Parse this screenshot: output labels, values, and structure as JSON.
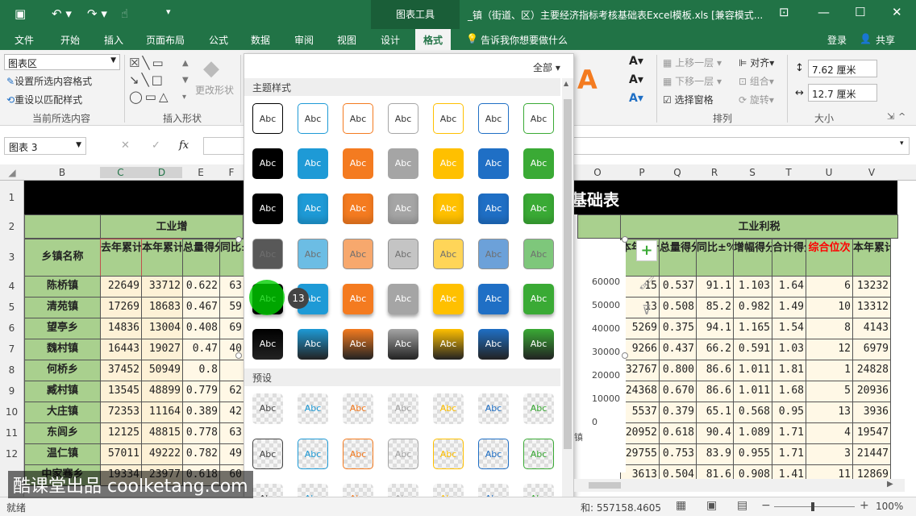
{
  "window": {
    "doc_title": "_镇（街道、区）主要经济指标考核基础表Excel模板.xls  [兼容模式...",
    "context_tools": "图表工具"
  },
  "tabs": [
    "文件",
    "开始",
    "插入",
    "页面布局",
    "公式",
    "数据",
    "审阅",
    "视图",
    "设计",
    "格式"
  ],
  "tell_me": "告诉我你想要做什么",
  "login": "登录",
  "share": "共享",
  "ribbon": {
    "selection_dropdown": "图表区",
    "format_selection": "设置所选内容格式",
    "reset_style": "重设以匹配样式",
    "group_current": "当前所选内容",
    "group_shapes": "插入形状",
    "change_shape": "更改形状",
    "bring_forward": "上移一层",
    "send_backward": "下移一层",
    "selection_pane": "选择窗格",
    "align": "对齐",
    "group": "组合",
    "rotate": "旋转",
    "group_arrange": "排列",
    "height": "7.62 厘米",
    "width": "12.7 厘米",
    "group_size": "大小"
  },
  "namebox": "图表 3",
  "fx": "fx",
  "gallery": {
    "filter": "全部",
    "section_theme": "主题样式",
    "section_preset": "预设",
    "swatch_label": "Abc",
    "callout": "13",
    "theme_colors": [
      "#000000",
      "#1e9ad6",
      "#f47b20",
      "#a5a5a5",
      "#ffc000",
      "#1f6fc5",
      "#3aaa35"
    ]
  },
  "columns_left": [
    "B",
    "C",
    "D",
    "E",
    "F"
  ],
  "columns_right": [
    "O",
    "P",
    "Q",
    "R",
    "S",
    "T",
    "U",
    "V"
  ],
  "rows": [
    "1",
    "2",
    "3",
    "4",
    "5",
    "6",
    "7",
    "8",
    "9",
    "10",
    "11",
    "12"
  ],
  "sheet": {
    "title_tail": "基础表",
    "group_industry_add": "工业增",
    "group_industry_profit": "工业利税",
    "hdr_left": [
      "乡镇名称",
      "去年累计",
      "本年累计",
      "总量得分",
      "同比±"
    ],
    "hdr_right": [
      "本年累计",
      "总量得分",
      "同比±%",
      "增幅得分",
      "合计得分",
      "综合位次",
      "本年累计"
    ],
    "data_left": [
      [
        "陈桥镇",
        "22649",
        "33712",
        "0.622",
        "63"
      ],
      [
        "清苑镇",
        "17269",
        "18683",
        "0.467",
        "59"
      ],
      [
        "望亭乡",
        "14836",
        "13004",
        "0.408",
        "69"
      ],
      [
        "魏村镇",
        "16443",
        "19027",
        "0.47",
        "40"
      ],
      [
        "何桥乡",
        "37452",
        "50949",
        "0.8",
        ""
      ],
      [
        "臧村镇",
        "13545",
        "48899",
        "0.779",
        "62"
      ],
      [
        "大庄镇",
        "72353",
        "11164",
        "0.389",
        "42"
      ],
      [
        "东闾乡",
        "12125",
        "48815",
        "0.778",
        "63"
      ],
      [
        "温仁镇",
        "57011",
        "49222",
        "0.782",
        "49"
      ],
      [
        "中家骞乡",
        "19334",
        "23977",
        "0.618",
        "60"
      ]
    ],
    "data_right": [
      [
        "15",
        "0.537",
        "91.1",
        "1.103",
        "1.64",
        "6",
        "13232"
      ],
      [
        "13",
        "0.508",
        "85.2",
        "0.982",
        "1.49",
        "10",
        "13312"
      ],
      [
        "5269",
        "0.375",
        "94.1",
        "1.165",
        "1.54",
        "8",
        "4143"
      ],
      [
        "9266",
        "0.437",
        "66.2",
        "0.591",
        "1.03",
        "12",
        "6979"
      ],
      [
        "32767",
        "0.800",
        "86.6",
        "1.011",
        "1.81",
        "1",
        "24828"
      ],
      [
        "24368",
        "0.670",
        "86.6",
        "1.011",
        "1.68",
        "5",
        "20936"
      ],
      [
        "5537",
        "0.379",
        "65.1",
        "0.568",
        "0.95",
        "13",
        "3936"
      ],
      [
        "20952",
        "0.618",
        "90.4",
        "1.089",
        "1.71",
        "4",
        "19547"
      ],
      [
        "29755",
        "0.753",
        "83.9",
        "0.955",
        "1.71",
        "3",
        "21447"
      ],
      [
        "3613",
        "0.504",
        "81.6",
        "0.908",
        "1.41",
        "11",
        "12869"
      ]
    ]
  },
  "chart_axis": [
    "60000",
    "50000",
    "40000",
    "30000",
    "20000",
    "10000",
    "0"
  ],
  "status": {
    "ready": "就绪",
    "sum": "和: 557158.4605",
    "zoom": "100%"
  },
  "watermark": "酷课堂出品 coolketang.com"
}
